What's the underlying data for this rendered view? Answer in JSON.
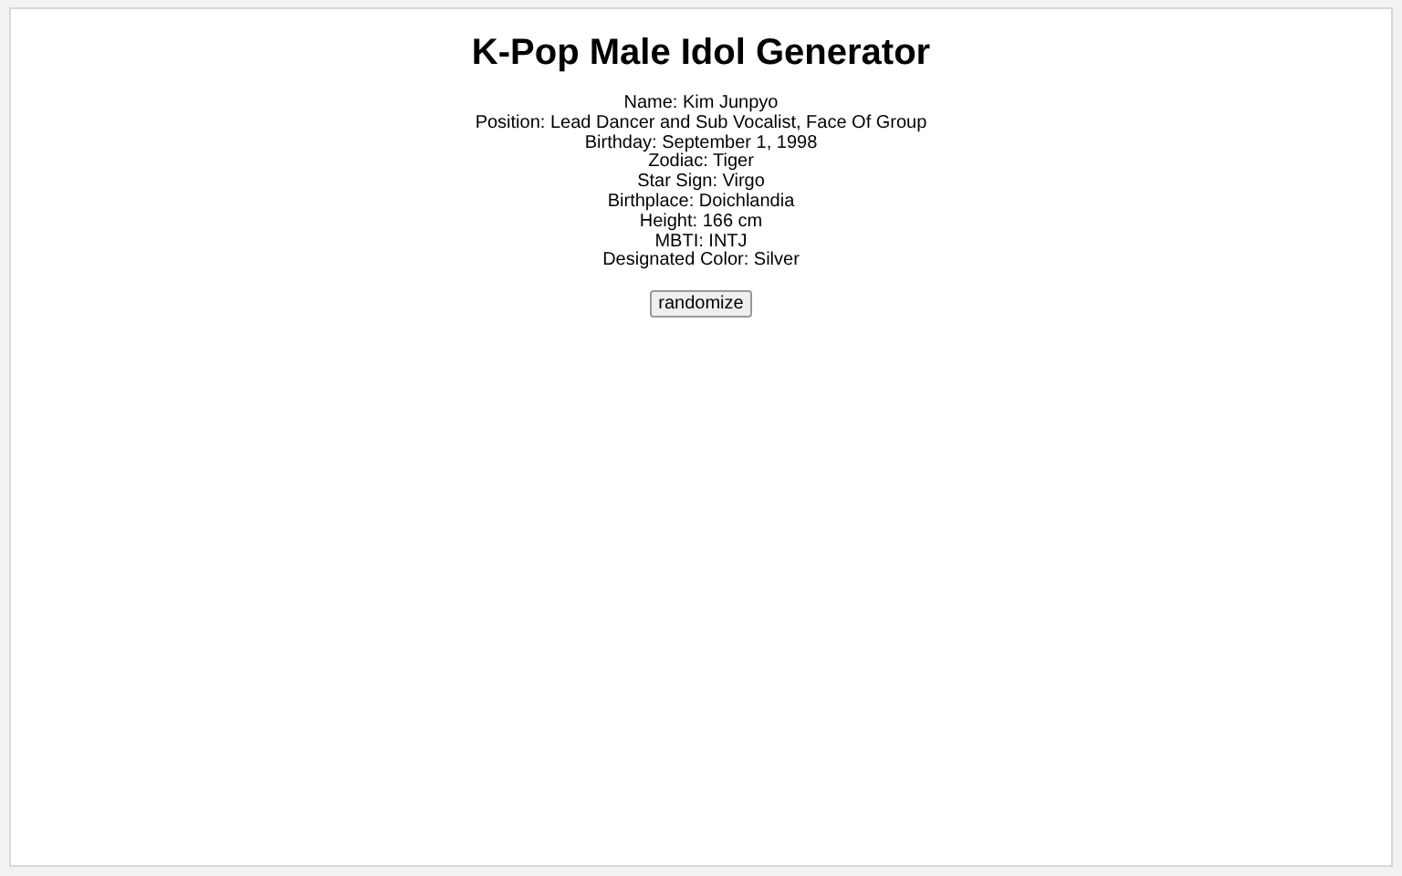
{
  "title": "K-Pop Male Idol Generator",
  "details": [
    "Name: Kim Junpyo",
    "Position: Lead Dancer and Sub Vocalist, Face Of Group",
    "Birthday: September 1, 1998",
    "Zodiac: Tiger",
    "Star Sign: Virgo",
    "Birthplace: Doichlandia",
    "Height: 166 cm",
    "MBTI: INTJ",
    "Designated Color: Silver"
  ],
  "button": "randomize"
}
